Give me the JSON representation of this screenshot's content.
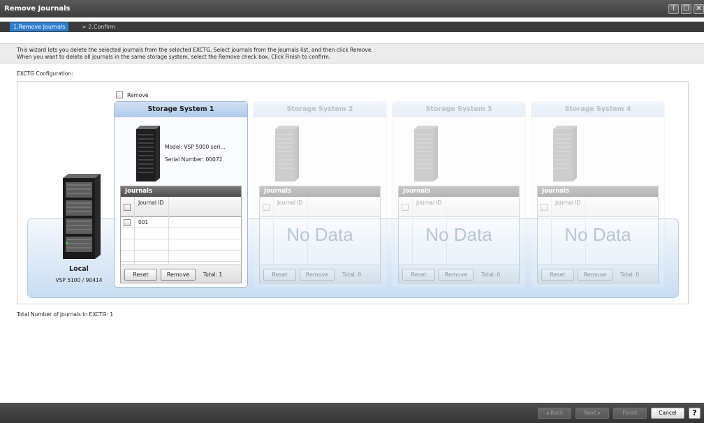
{
  "window": {
    "title": "Remove Journals",
    "buttons": [
      "⊤",
      "☐",
      "✕"
    ]
  },
  "breadcrumb": {
    "step1": "1.Remove Journals",
    "step2": "> 2.Confirm"
  },
  "instructions": {
    "line1": "This wizard lets you delete the selected journals from the selected EXCTG.  Select journals from the Journals list, and then click Remove.",
    "line2": "When you want to delete all journals in the same storage system, select the Remove check box. Click Finish to confirm."
  },
  "config": {
    "label": "EXCTG Configuration:",
    "remove_label": "Remove",
    "local": {
      "name": "Local",
      "subtitle": "VSP 5100 / 90414"
    },
    "systems": [
      {
        "title": "Storage System 1",
        "model": "Model:  VSP 5000 seri...",
        "serial": "Serial Number:  00072",
        "journals_header": "Journals",
        "col_journal_id": "Journal ID",
        "rows": [
          "001"
        ],
        "reset_label": "Reset",
        "remove_label": "Remove",
        "total_label": "Total:  1"
      },
      {
        "title": "Storage System 2",
        "journals_header": "Journals",
        "col_journal_id": "Journal ID",
        "no_data": "No Data",
        "reset_label": "Reset",
        "remove_label": "Remove",
        "total_label": "Total:  0"
      },
      {
        "title": "Storage System 3",
        "journals_header": "Journals",
        "col_journal_id": "Journal ID",
        "no_data": "No Data",
        "reset_label": "Reset",
        "remove_label": "Remove",
        "total_label": "Total:  0"
      },
      {
        "title": "Storage System 4",
        "journals_header": "Journals",
        "col_journal_id": "Journal ID",
        "no_data": "No Data",
        "reset_label": "Reset",
        "remove_label": "Remove",
        "total_label": "Total:  0"
      }
    ]
  },
  "summary": {
    "total_journals": "Total Number of Journals in EXCTG:  1"
  },
  "footer": {
    "back": "◂ Back",
    "next": "Next ▸",
    "finish": "Finish",
    "cancel": "Cancel",
    "help": "?"
  },
  "colors": {
    "accent_blue": "#2d7fd0",
    "panel_head_active": "#aecbec",
    "titlebar": "#4a4a4a"
  }
}
